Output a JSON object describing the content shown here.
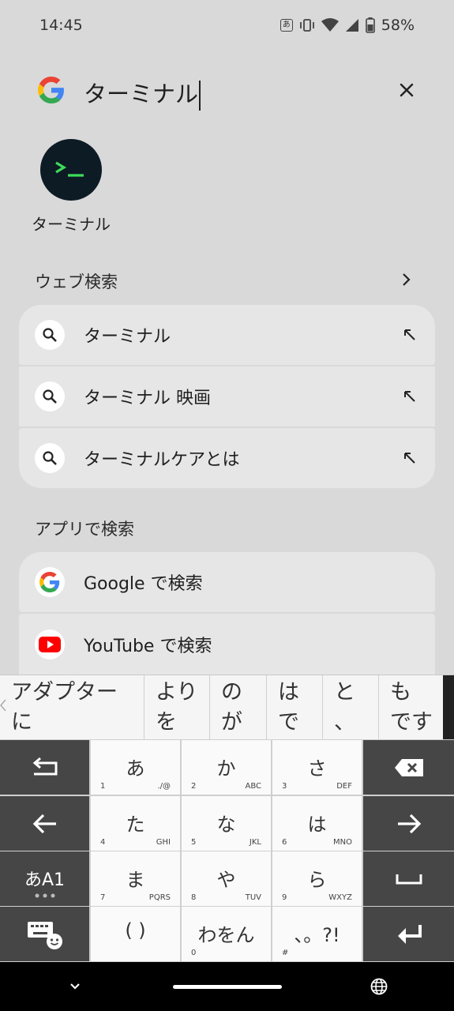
{
  "status": {
    "time": "14:45",
    "ime": "あ",
    "battery": "58%"
  },
  "search": {
    "query": "ターミナル"
  },
  "app_result": {
    "label": "ターミナル",
    "icon": "terminal-icon"
  },
  "web_search": {
    "title": "ウェブ検索",
    "items": [
      {
        "label": "ターミナル"
      },
      {
        "label": "ターミナル 映画"
      },
      {
        "label": "ターミナルケアとは"
      }
    ]
  },
  "app_search": {
    "title": "アプリで検索",
    "items": [
      {
        "label": "Google で検索",
        "icon": "google-icon"
      },
      {
        "label": "YouTube で検索",
        "icon": "youtube-icon"
      }
    ]
  },
  "suggestions": [
    {
      "line1": "アダプター",
      "line2": "に"
    },
    {
      "line1": "より",
      "line2": "を"
    },
    {
      "line1": "の",
      "line2": "が"
    },
    {
      "line1": "は",
      "line2": "で"
    },
    {
      "line1": "と",
      "line2": "、"
    },
    {
      "line1": "も",
      "line2": "です"
    }
  ],
  "keyboard": {
    "keys": {
      "a": {
        "main": "あ",
        "num": "1",
        "sub": "./@"
      },
      "ka": {
        "main": "か",
        "num": "2",
        "sub": "ABC"
      },
      "sa": {
        "main": "さ",
        "num": "3",
        "sub": "DEF"
      },
      "ta": {
        "main": "た",
        "num": "4",
        "sub": "GHI"
      },
      "na": {
        "main": "な",
        "num": "5",
        "sub": "JKL"
      },
      "ha": {
        "main": "は",
        "num": "6",
        "sub": "MNO"
      },
      "ma": {
        "main": "ま",
        "num": "7",
        "sub": "PQRS"
      },
      "ya": {
        "main": "や",
        "num": "8",
        "sub": "TUV"
      },
      "ra": {
        "main": "ら",
        "num": "9",
        "sub": "WXYZ"
      },
      "paren": {
        "main": "( )",
        "num": "",
        "sub": ""
      },
      "wa": {
        "main": "わをん",
        "num": "0",
        "sub": ""
      },
      "punct": {
        "main": "、。?!",
        "num": "#",
        "sub": ""
      }
    },
    "mode_label": "あA1"
  },
  "colors": {
    "background": "#d9d9d9",
    "card": "#e6e6e6",
    "terminal_green": "#3ddc5a",
    "youtube_red": "#ff0000"
  }
}
